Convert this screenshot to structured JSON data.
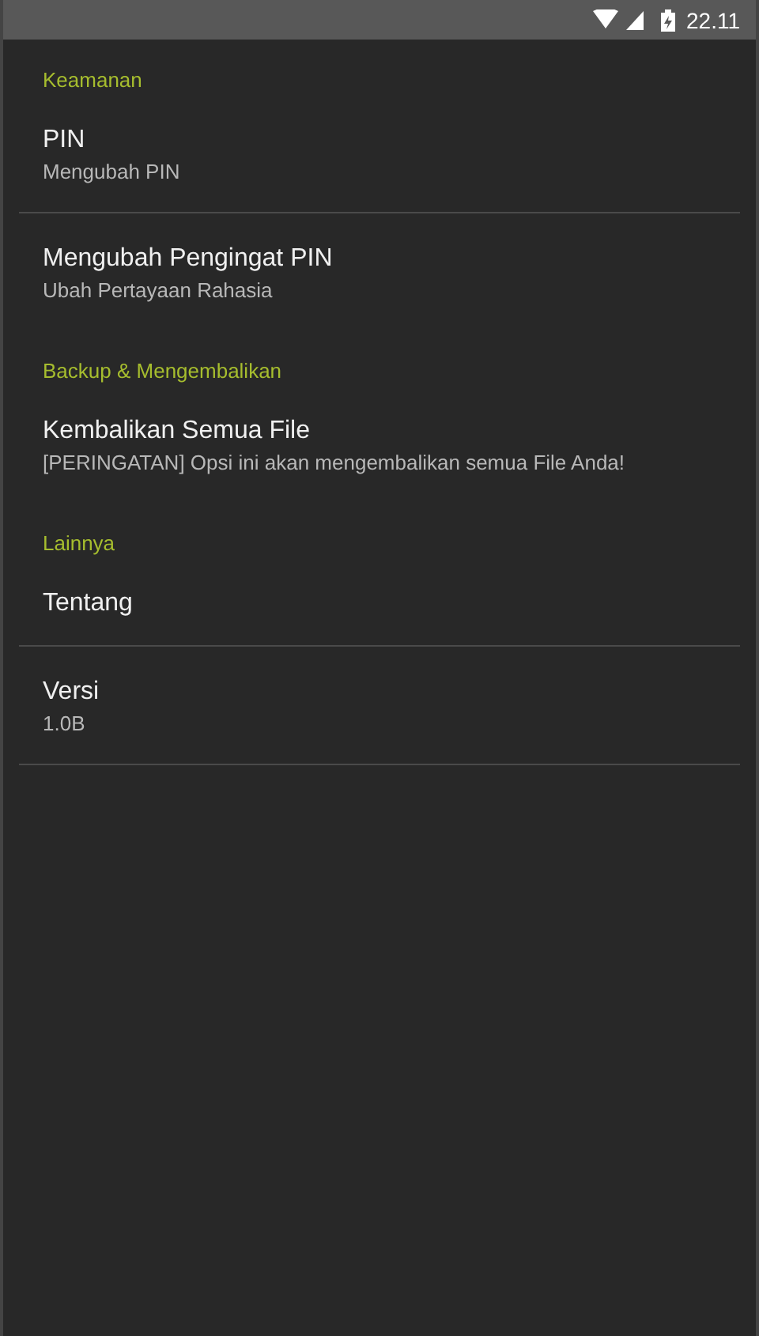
{
  "status_bar": {
    "time": "22.11"
  },
  "sections": [
    {
      "header": "Keamanan",
      "items": [
        {
          "title": "PIN",
          "summary": "Mengubah PIN",
          "divider": true
        },
        {
          "title": "Mengubah Pengingat PIN",
          "summary": "Ubah Pertayaan Rahasia",
          "divider": false
        }
      ]
    },
    {
      "header": "Backup & Mengembalikan",
      "items": [
        {
          "title": "Kembalikan Semua File",
          "summary": "[PERINGATAN] Opsi ini akan mengembalikan semua File Anda!",
          "divider": false
        }
      ]
    },
    {
      "header": "Lainnya",
      "items": [
        {
          "title": "Tentang",
          "divider": true
        },
        {
          "title": "Versi",
          "summary": "1.0B",
          "divider": true
        }
      ]
    }
  ]
}
